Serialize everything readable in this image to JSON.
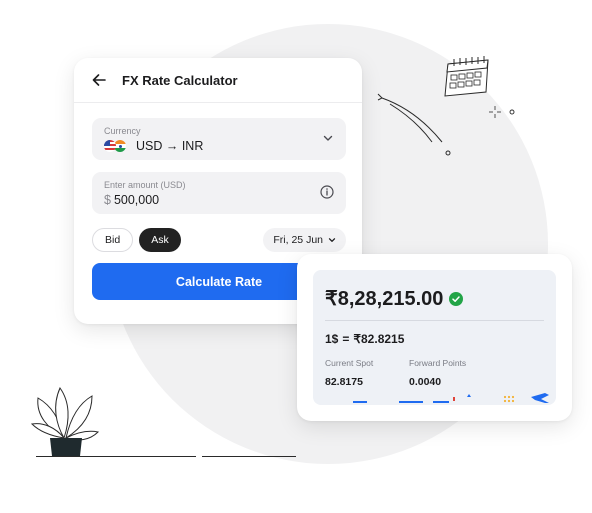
{
  "calculator": {
    "title": "FX Rate Calculator",
    "currency_label": "Currency",
    "currency_value": "USD → INR",
    "amount_label": "Enter amount (USD)",
    "amount_currency": "$",
    "amount_value": "500,000",
    "bid_label": "Bid",
    "ask_label": "Ask",
    "selected_side": "Ask",
    "date_label": "Fri, 25 Jun",
    "calculate_label": "Calculate Rate"
  },
  "result": {
    "total": "₹8,28,215.00",
    "rate_left": "1$",
    "rate_eq": "=",
    "rate_right": "₹82.8215",
    "current_spot_label": "Current Spot",
    "current_spot_value": "82.8175",
    "forward_points_label": "Forward Points",
    "forward_points_value": "0.0040"
  },
  "colors": {
    "accent": "#1f6bf0",
    "success": "#22a447",
    "background_circle": "#f1f1f2"
  },
  "icons": [
    "back-arrow-icon",
    "usa-flag-icon",
    "india-flag-icon",
    "chevron-down-icon",
    "info-icon",
    "check-circle-icon",
    "calendar-illustration",
    "plant-illustration"
  ]
}
